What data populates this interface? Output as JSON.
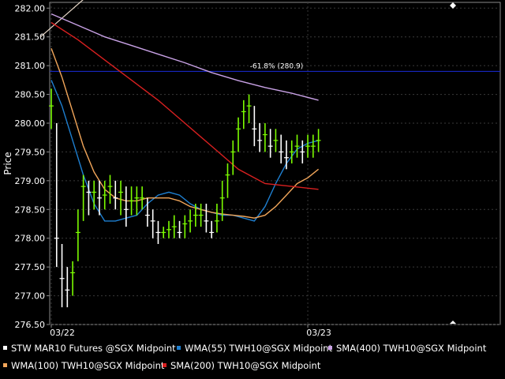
{
  "chart_data": {
    "type": "candlestick",
    "ylabel": "Price",
    "ylim": [
      276.5,
      282.1
    ],
    "y_ticks": [
      "282.00",
      "281.50",
      "281.00",
      "280.50",
      "280.00",
      "279.50",
      "279.00",
      "278.50",
      "278.00",
      "277.50",
      "277.00",
      "276.50"
    ],
    "y_tick_values": [
      282.0,
      281.5,
      281.0,
      280.5,
      280.0,
      279.5,
      279.0,
      278.5,
      278.0,
      277.5,
      277.0,
      276.5
    ],
    "x_ticks": [
      "03/22",
      "03/23"
    ],
    "x_tick_positions": [
      0,
      48
    ],
    "xlim": [
      0,
      79
    ],
    "grid": true,
    "annotation": {
      "text": "-61.8% (280.9)",
      "value": 280.9,
      "color": "#1a2bd8"
    },
    "series": [
      {
        "name": "STW MAR10 Futures @SGX Midpoint",
        "kind": "price",
        "color": "#ffffff"
      },
      {
        "name": "WMA(55) TWH10@SGX Midpoint",
        "color": "#1e7fd0",
        "x": [
          0,
          2,
          4,
          6,
          8,
          10,
          12,
          14,
          16,
          18,
          20,
          22,
          24,
          26,
          28,
          30,
          32,
          34,
          36,
          38,
          40,
          42,
          44,
          46,
          48,
          50
        ],
        "values": [
          280.75,
          280.3,
          279.7,
          279.1,
          278.6,
          278.3,
          278.3,
          278.35,
          278.4,
          278.6,
          278.75,
          278.8,
          278.75,
          278.6,
          278.5,
          278.45,
          278.4,
          278.4,
          278.35,
          278.3,
          278.55,
          278.95,
          279.3,
          279.55,
          279.65,
          279.7
        ]
      },
      {
        "name": "SMA(400) TWH10@SGX Midpoint",
        "color": "#c9a2e6",
        "x": [
          0,
          5,
          10,
          15,
          20,
          25,
          30,
          35,
          40,
          45,
          50
        ],
        "values": [
          281.9,
          281.7,
          281.5,
          281.35,
          281.2,
          281.05,
          280.88,
          280.74,
          280.62,
          280.52,
          280.4
        ]
      },
      {
        "name": "WMA(100) TWH10@SGX Midpoint",
        "color": "#f2a65a",
        "x": [
          0,
          2,
          4,
          6,
          8,
          10,
          12,
          14,
          16,
          18,
          20,
          22,
          24,
          26,
          28,
          30,
          32,
          34,
          36,
          38,
          40,
          42,
          44,
          46,
          48,
          50
        ],
        "values": [
          281.3,
          280.8,
          280.2,
          279.6,
          279.15,
          278.85,
          278.7,
          278.65,
          278.65,
          278.7,
          278.7,
          278.7,
          278.65,
          278.55,
          278.5,
          278.45,
          278.42,
          278.4,
          278.38,
          278.35,
          278.4,
          278.55,
          278.75,
          278.95,
          279.05,
          279.2
        ]
      },
      {
        "name": "SMA(200) TWH10@SGX Midpoint",
        "color": "#d92020",
        "x": [
          0,
          5,
          10,
          15,
          20,
          25,
          30,
          35,
          40,
          45,
          50
        ],
        "values": [
          281.75,
          281.45,
          281.1,
          280.75,
          280.4,
          280.0,
          279.6,
          279.2,
          278.95,
          278.9,
          278.85
        ]
      }
    ],
    "bars": {
      "x": [
        0,
        1,
        2,
        3,
        4,
        5,
        6,
        7,
        8,
        9,
        10,
        11,
        12,
        13,
        14,
        15,
        16,
        17,
        18,
        19,
        20,
        21,
        22,
        23,
        24,
        25,
        26,
        27,
        28,
        29,
        30,
        31,
        32,
        33,
        34,
        35,
        36,
        37,
        38,
        39,
        40,
        41,
        42,
        43,
        44,
        45,
        46,
        47,
        48,
        49,
        50
      ],
      "values": [
        280.3,
        278.0,
        277.3,
        277.1,
        277.4,
        278.1,
        278.9,
        278.8,
        278.8,
        278.7,
        278.75,
        278.9,
        278.7,
        278.8,
        278.5,
        278.65,
        278.7,
        278.7,
        278.4,
        278.3,
        278.1,
        278.1,
        278.15,
        278.2,
        278.1,
        278.25,
        278.3,
        278.4,
        278.4,
        278.3,
        278.1,
        278.3,
        278.7,
        279.1,
        279.5,
        279.9,
        280.2,
        280.3,
        279.9,
        279.7,
        279.8,
        279.6,
        279.7,
        279.5,
        279.4,
        279.5,
        279.6,
        279.5,
        279.6,
        279.6,
        279.7
      ],
      "high": [
        280.6,
        280.0,
        277.9,
        277.5,
        277.6,
        278.5,
        279.1,
        279.0,
        279.0,
        279.0,
        279.0,
        279.1,
        279.0,
        279.0,
        278.9,
        278.9,
        278.9,
        278.9,
        278.7,
        278.5,
        278.3,
        278.2,
        278.3,
        278.4,
        278.3,
        278.4,
        278.5,
        278.6,
        278.6,
        278.6,
        278.3,
        278.6,
        279.0,
        279.3,
        279.7,
        280.1,
        280.4,
        280.5,
        280.3,
        280.0,
        280.0,
        279.9,
        279.9,
        279.8,
        279.7,
        279.7,
        279.8,
        279.7,
        279.8,
        279.8,
        279.9
      ],
      "low": [
        279.9,
        277.5,
        276.8,
        276.8,
        277.0,
        277.6,
        278.3,
        278.4,
        278.5,
        278.4,
        278.5,
        278.6,
        278.5,
        278.4,
        278.2,
        278.4,
        278.4,
        278.5,
        278.2,
        278.0,
        277.9,
        278.0,
        278.0,
        278.0,
        278.0,
        278.0,
        278.1,
        278.2,
        278.2,
        278.1,
        278.0,
        278.1,
        278.3,
        278.7,
        279.1,
        279.5,
        279.9,
        280.0,
        279.6,
        279.5,
        279.5,
        279.4,
        279.5,
        279.3,
        279.2,
        279.3,
        279.4,
        279.3,
        279.4,
        279.4,
        279.5
      ]
    },
    "overlay_lines": [
      {
        "x1": -2,
        "y1": 281.5,
        "x2": 6,
        "y2": 282.15,
        "color": "#e8d8c8"
      }
    ]
  }
}
